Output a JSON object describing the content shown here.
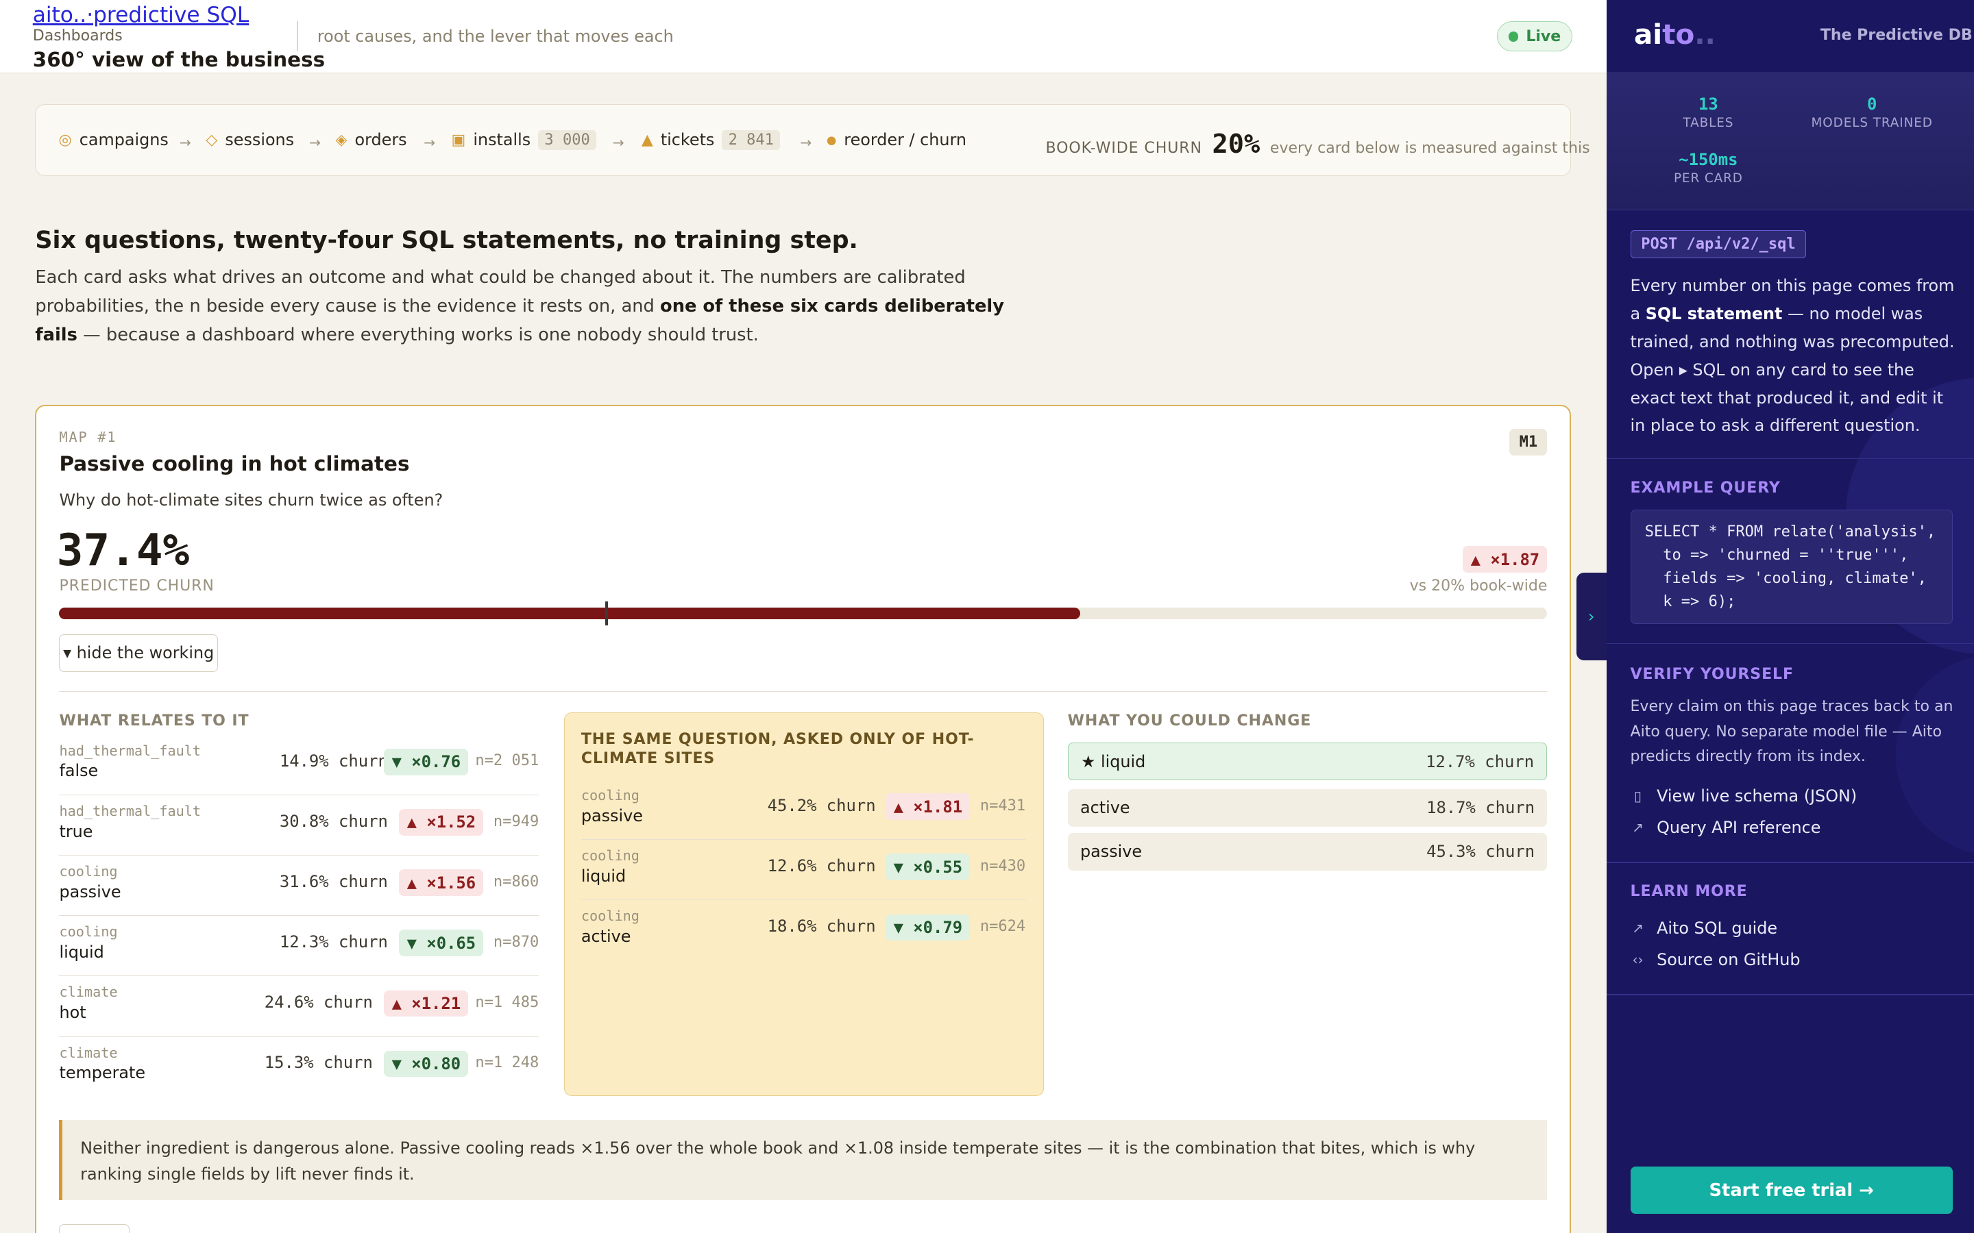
{
  "topbar": {
    "brand_link": "aito..·predictive SQL",
    "breadcrumb": "Dashboards",
    "title": "360° view of the business",
    "subtitle": "root causes, and the lever that moves each",
    "live": "Live"
  },
  "pipeline": {
    "items": [
      {
        "icon": "◎",
        "label": "campaigns",
        "count": ""
      },
      {
        "icon": "◇",
        "label": "sessions",
        "count": ""
      },
      {
        "icon": "◈",
        "label": "orders",
        "count": ""
      },
      {
        "icon": "▣",
        "label": "installs",
        "count": "3 000"
      },
      {
        "icon": "▲",
        "label": "tickets",
        "count": "2 841"
      },
      {
        "icon": "●",
        "label": "reorder / churn",
        "count": ""
      }
    ],
    "arrow": "→",
    "book_label": "BOOK-WIDE CHURN",
    "book_value": "20%",
    "book_note": "every card below is measured against this"
  },
  "intro": {
    "heading": "Six questions, twenty-four SQL statements, no training step.",
    "p1": "Each card asks what drives an outcome and what could be changed about it. The numbers are calibrated probabilities, the n beside every cause is the evidence it rests on, and ",
    "p_bold": "one of these six cards deliberately fails",
    "p2": " — because a dashboard where everything works is one nobody should trust."
  },
  "card": {
    "map_label": "MAP #1",
    "title": "Passive cooling in hot climates",
    "badge": "M1",
    "question": "Why do hot-climate sites churn twice as often?",
    "predicted": "37.4%",
    "predicted_label": "PREDICTED CHURN",
    "predicted_fraction": 0.374,
    "baseline_fraction": 0.2,
    "lift": "▲ ×1.87",
    "vs": "vs 20% book-wide",
    "hide_button": "▾ hide the working",
    "relates_heading": "WHAT RELATES TO IT",
    "relates": [
      {
        "field": "had_thermal_fault",
        "value": "false",
        "churn": "14.9% churn",
        "lift": "▼ ×0.76",
        "dir": "down",
        "n": "n=2 051"
      },
      {
        "field": "had_thermal_fault",
        "value": "true",
        "churn": "30.8% churn",
        "lift": "▲ ×1.52",
        "dir": "up",
        "n": "n=949"
      },
      {
        "field": "cooling",
        "value": "passive",
        "churn": "31.6% churn",
        "lift": "▲ ×1.56",
        "dir": "up",
        "n": "n=860"
      },
      {
        "field": "cooling",
        "value": "liquid",
        "churn": "12.3% churn",
        "lift": "▼ ×0.65",
        "dir": "down",
        "n": "n=870"
      },
      {
        "field": "climate",
        "value": "hot",
        "churn": "24.6% churn",
        "lift": "▲ ×1.21",
        "dir": "up",
        "n": "n=1 485"
      },
      {
        "field": "climate",
        "value": "temperate",
        "churn": "15.3% churn",
        "lift": "▼ ×0.80",
        "dir": "down",
        "n": "n=1 248"
      }
    ],
    "subq_heading": "THE SAME QUESTION, ASKED ONLY OF HOT-CLIMATE SITES",
    "subq": [
      {
        "field": "cooling",
        "value": "passive",
        "churn": "45.2% churn",
        "lift": "▲ ×1.81",
        "dir": "up",
        "n": "n=431"
      },
      {
        "field": "cooling",
        "value": "liquid",
        "churn": "12.6% churn",
        "lift": "▼ ×0.55",
        "dir": "down",
        "n": "n=430"
      },
      {
        "field": "cooling",
        "value": "active",
        "churn": "18.6% churn",
        "lift": "▼ ×0.79",
        "dir": "down",
        "n": "n=624"
      }
    ],
    "change_heading": "WHAT YOU COULD CHANGE",
    "changes": [
      {
        "name": "★ liquid",
        "value": "12.7% churn",
        "best": true
      },
      {
        "name": "active",
        "value": "18.7% churn",
        "best": false
      },
      {
        "name": "passive",
        "value": "45.3% churn",
        "best": false
      }
    ],
    "callout": "Neither ingredient is dangerous alone. Passive cooling reads ×1.56 over the whole book and ×1.08 inside temperate sites — it is the combination that bites, which is why ranking single fields by lift never finds it."
  },
  "handle": "›",
  "sidebar": {
    "logo_ai": "ai",
    "logo_to": "to",
    "logo_dots": "..",
    "tagline": "The Predictive DB",
    "stats": [
      {
        "value": "13",
        "label": "TABLES"
      },
      {
        "value": "0",
        "label": "MODELS TRAINED"
      },
      {
        "value": "~150ms",
        "label": "PER CARD"
      }
    ],
    "endpoint": "POST /api/v2/_sql",
    "para_a": "Every number on this page comes from a ",
    "para_bold": "SQL statement",
    "para_b": " — no model was trained, and nothing was precomputed. Open ▸ SQL on any card to see the exact text that produced it, and edit it in place to ask a different question.",
    "example_heading": "EXAMPLE QUERY",
    "example_code": "SELECT * FROM relate('analysis',\n  to => 'churned = ''true''',\n  fields => 'cooling, climate',\n  k => 6);",
    "verify_heading": "VERIFY YOURSELF",
    "verify_text": "Every claim on this page traces back to an Aito query. No separate model file — Aito predicts directly from its index.",
    "verify_links": [
      "View live schema (JSON)",
      "Query API reference"
    ],
    "learn_heading": "LEARN MORE",
    "learn_links": [
      "Aito SQL guide",
      "Source on GitHub"
    ],
    "cta": "Start free trial →"
  }
}
